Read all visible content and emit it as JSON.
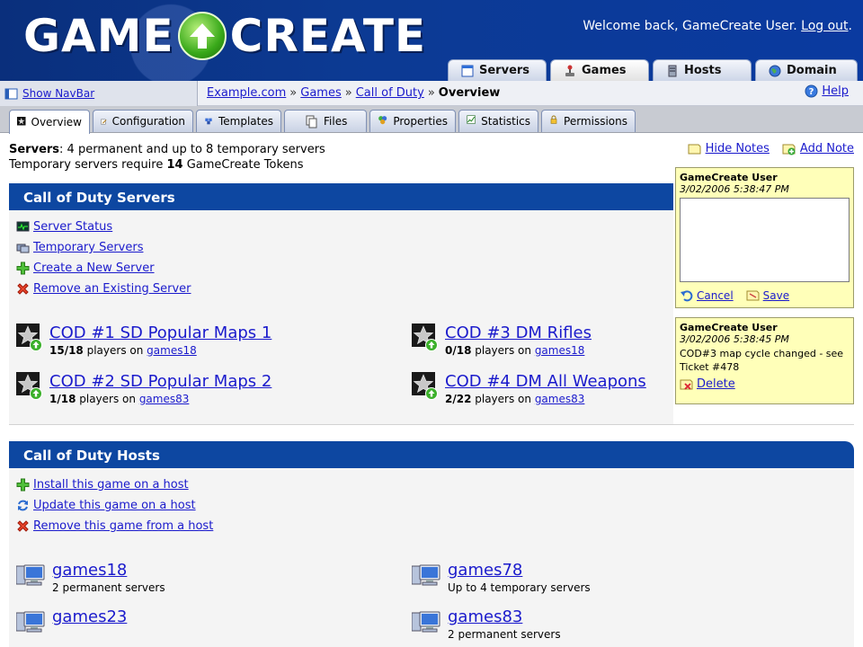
{
  "header": {
    "logo_left": "GAME",
    "logo_right": "CREATE",
    "welcome_text": "Welcome back, GameCreate User.",
    "logout_label": "Log out",
    "period": "."
  },
  "main_nav": {
    "tabs": [
      {
        "label": "Servers",
        "icon": "window-icon",
        "active": false
      },
      {
        "label": "Games",
        "icon": "joystick-icon",
        "active": true
      },
      {
        "label": "Hosts",
        "icon": "server-icon",
        "active": false
      },
      {
        "label": "Domain",
        "icon": "globe-icon",
        "active": false
      }
    ]
  },
  "navbar": {
    "toggle_label": "Show NavBar"
  },
  "breadcrumb": {
    "items": [
      "Example.com",
      "Games",
      "Call of Duty"
    ],
    "current": "Overview",
    "sep": "»"
  },
  "help": {
    "label": "Help"
  },
  "sub_tabs": [
    {
      "label": "Overview",
      "active": true
    },
    {
      "label": "Configuration",
      "active": false
    },
    {
      "label": "Templates",
      "active": false
    },
    {
      "label": "Files",
      "active": false
    },
    {
      "label": "Properties",
      "active": false
    },
    {
      "label": "Statistics",
      "active": false
    },
    {
      "label": "Permissions",
      "active": false
    }
  ],
  "info": {
    "servers_label": "Servers",
    "servers_text": ": 4 permanent and up to 8 temporary servers",
    "tokens_prefix": "Temporary servers require ",
    "tokens_count": "14",
    "tokens_suffix": " GameCreate Tokens"
  },
  "notes": {
    "hide_label": "Hide Notes",
    "add_label": "Add Note",
    "editor": {
      "user": "GameCreate User",
      "timestamp": "3/02/2006 5:38:47 PM",
      "text": "",
      "cancel_label": "Cancel",
      "save_label": "Save"
    },
    "note": {
      "user": "GameCreate User",
      "timestamp": "3/02/2006 5:38:45 PM",
      "text": "COD#3 map cycle changed - see Ticket #478",
      "delete_label": "Delete"
    }
  },
  "servers_section": {
    "title": "Call of Duty Servers",
    "actions": [
      {
        "label": "Server Status",
        "icon": "monitor-icon"
      },
      {
        "label": "Temporary Servers",
        "icon": "servers-icon"
      },
      {
        "label": "Create a New Server",
        "icon": "add-icon"
      },
      {
        "label": "Remove an Existing Server",
        "icon": "remove-icon"
      }
    ],
    "servers": [
      {
        "name": "COD #1 SD Popular Maps 1",
        "players": "15/18",
        "mid": " players on ",
        "host": "games18"
      },
      {
        "name": "COD #3 DM Rifles",
        "players": "0/18",
        "mid": " players on ",
        "host": "games18"
      },
      {
        "name": "COD #2 SD Popular Maps 2",
        "players": "1/18",
        "mid": " players on ",
        "host": "games83"
      },
      {
        "name": "COD #4 DM All Weapons",
        "players": "2/22",
        "mid": " players on ",
        "host": "games83"
      }
    ]
  },
  "hosts_section": {
    "title": "Call of Duty Hosts",
    "actions": [
      {
        "label": "Install this game on a host",
        "icon": "add-icon"
      },
      {
        "label": "Update this game on a host",
        "icon": "update-icon"
      },
      {
        "label": "Remove this game from a host",
        "icon": "remove-icon"
      }
    ],
    "hosts": [
      {
        "name": "games18",
        "detail": "2 permanent servers"
      },
      {
        "name": "games78",
        "detail": "Up to 4 temporary servers"
      },
      {
        "name": "games23",
        "detail": ""
      },
      {
        "name": "games83",
        "detail": "2 permanent servers"
      }
    ]
  }
}
